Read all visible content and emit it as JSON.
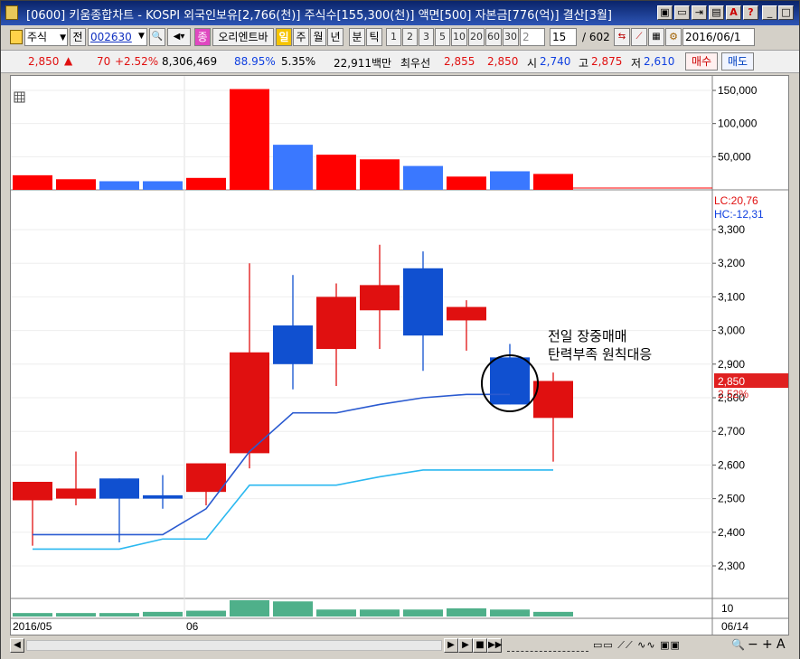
{
  "window": {
    "title": "[0600] 키움종합차트 - KOSPI 외국인보유[2,766(천)] 주식수[155,300(천)] 액면[500] 자본금[776(억)] 결산[3월]",
    "controls": [
      "▣",
      "▭",
      "⇥",
      "▤",
      "A",
      "?",
      "_",
      "□",
      "×"
    ]
  },
  "toolbar": {
    "market_label": "주식",
    "prev_label": "전",
    "code_value": "002630",
    "company_button": "오리엔트바",
    "period_prefix": "종",
    "periods": [
      "일",
      "주",
      "월",
      "년",
      "분",
      "틱"
    ],
    "active_period": "일",
    "intervals": [
      "1",
      "2",
      "3",
      "5",
      "10",
      "20",
      "60",
      "30",
      "2"
    ],
    "count_value": "15",
    "count_total": "/ 602",
    "date_value": "2016/06/1"
  },
  "quote": {
    "price": "2,850",
    "change_arrow": "▲",
    "change": "70",
    "change_pct": "+2.52%",
    "volume": "8,306,469",
    "ratio": "88.95%",
    "turnover": "5.35%",
    "amount": "22,911백만",
    "best_label": "최우선",
    "best_ask": "2,855",
    "best_bid": "2,850",
    "open_label": "시",
    "open": "2,740",
    "high_label": "고",
    "high": "2,875",
    "low_label": "저",
    "low": "2,610",
    "buy_label": "매수",
    "sell_label": "매도"
  },
  "indicator": {
    "lc_label": "LC:20,76",
    "hc_label": "HC:-12,31"
  },
  "price_tag": {
    "price": "2,850",
    "pct": "2.52%"
  },
  "annotation": {
    "line1": "전일 장중매매",
    "line2": "탄력부족 원칙대응"
  },
  "bottom": {
    "axis_value": "10"
  },
  "date_labels": {
    "left": "2016/05",
    "mid": "06",
    "right": "06/14"
  },
  "colors": {
    "up": "#e01010",
    "down": "#1050d0",
    "volume_up": "#ff0000",
    "volume_down": "#3a78ff",
    "ma_short": "#2a5ad0",
    "ma_long": "#2ab8f0",
    "sub_bar": "#4fb08a"
  },
  "chart_data": {
    "type": "candlestick",
    "candles": [
      {
        "o": 2550,
        "h": 2550,
        "l": 2360,
        "c": 2495,
        "up": true
      },
      {
        "o": 2530,
        "h": 2640,
        "l": 2480,
        "c": 2500,
        "up": true
      },
      {
        "o": 2500,
        "h": 2560,
        "l": 2370,
        "c": 2560,
        "up": false
      },
      {
        "o": 2510,
        "h": 2570,
        "l": 2470,
        "c": 2500,
        "up": false
      },
      {
        "o": 2520,
        "h": 2605,
        "l": 2480,
        "c": 2605,
        "up": true
      },
      {
        "o": 2635,
        "h": 3200,
        "l": 2590,
        "c": 2935,
        "up": true
      },
      {
        "o": 3015,
        "h": 3165,
        "l": 2825,
        "c": 2900,
        "up": false
      },
      {
        "o": 3100,
        "h": 3140,
        "l": 2835,
        "c": 2945,
        "up": true
      },
      {
        "o": 3135,
        "h": 3255,
        "l": 2945,
        "c": 3060,
        "up": true
      },
      {
        "o": 3185,
        "h": 3235,
        "l": 2880,
        "c": 2985,
        "up": false
      },
      {
        "o": 3070,
        "h": 3090,
        "l": 2940,
        "c": 3030,
        "up": true
      },
      {
        "o": 2920,
        "h": 2960,
        "l": 2780,
        "c": 2780,
        "up": false
      },
      {
        "o": 2850,
        "h": 2875,
        "l": 2610,
        "c": 2740,
        "up": true
      }
    ],
    "volumes": [
      22000,
      16000,
      13000,
      13000,
      18000,
      152000,
      68000,
      53000,
      46000,
      36000,
      20000,
      28000,
      24000
    ],
    "ma_short": [
      2393,
      2393,
      2393,
      2393,
      2470,
      2640,
      2755,
      2755,
      2780,
      2800,
      2810,
      2810
    ],
    "ma_long": [
      2350,
      2350,
      2350,
      2380,
      2380,
      2540,
      2540,
      2540,
      2565,
      2585,
      2585,
      2585,
      2585
    ],
    "sub_values": [
      3,
      3,
      3,
      4,
      5,
      14,
      13,
      6,
      6,
      6,
      7,
      6,
      4
    ],
    "price_axis": {
      "min": 2300,
      "max": 3300,
      "ticks": [
        "3,300",
        "3,200",
        "3,100",
        "3,000",
        "2,900",
        "2,800",
        "2,700",
        "2,600",
        "2,500",
        "2,400",
        "2,300"
      ]
    },
    "volume_axis": {
      "max": 150000,
      "ticks": [
        "150,000",
        "100,000",
        "50,000"
      ]
    }
  }
}
